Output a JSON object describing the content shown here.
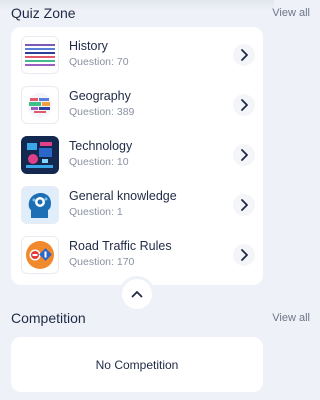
{
  "quiz_zone": {
    "title": "Quiz Zone",
    "view_all": "View all",
    "items": [
      {
        "name": "History",
        "count": "Question: 70",
        "icon": "history-lines-icon"
      },
      {
        "name": "Geography",
        "count": "Question: 389",
        "icon": "geography-word-cloud-icon"
      },
      {
        "name": "Technology",
        "count": "Question: 10",
        "icon": "technology-icon"
      },
      {
        "name": "General knowledge",
        "count": "Question: 1",
        "icon": "brain-head-icon"
      },
      {
        "name": "Road Traffic Rules",
        "count": "Question: 170",
        "icon": "traffic-signs-icon"
      }
    ],
    "collapse_icon": "chevron-up-icon"
  },
  "competition": {
    "title": "Competition",
    "view_all": "View all",
    "empty_text": "No Competition"
  },
  "colors": {
    "background": "#eef1f7",
    "card": "#ffffff",
    "text": "#1f2a44",
    "muted": "#8a91a1"
  }
}
